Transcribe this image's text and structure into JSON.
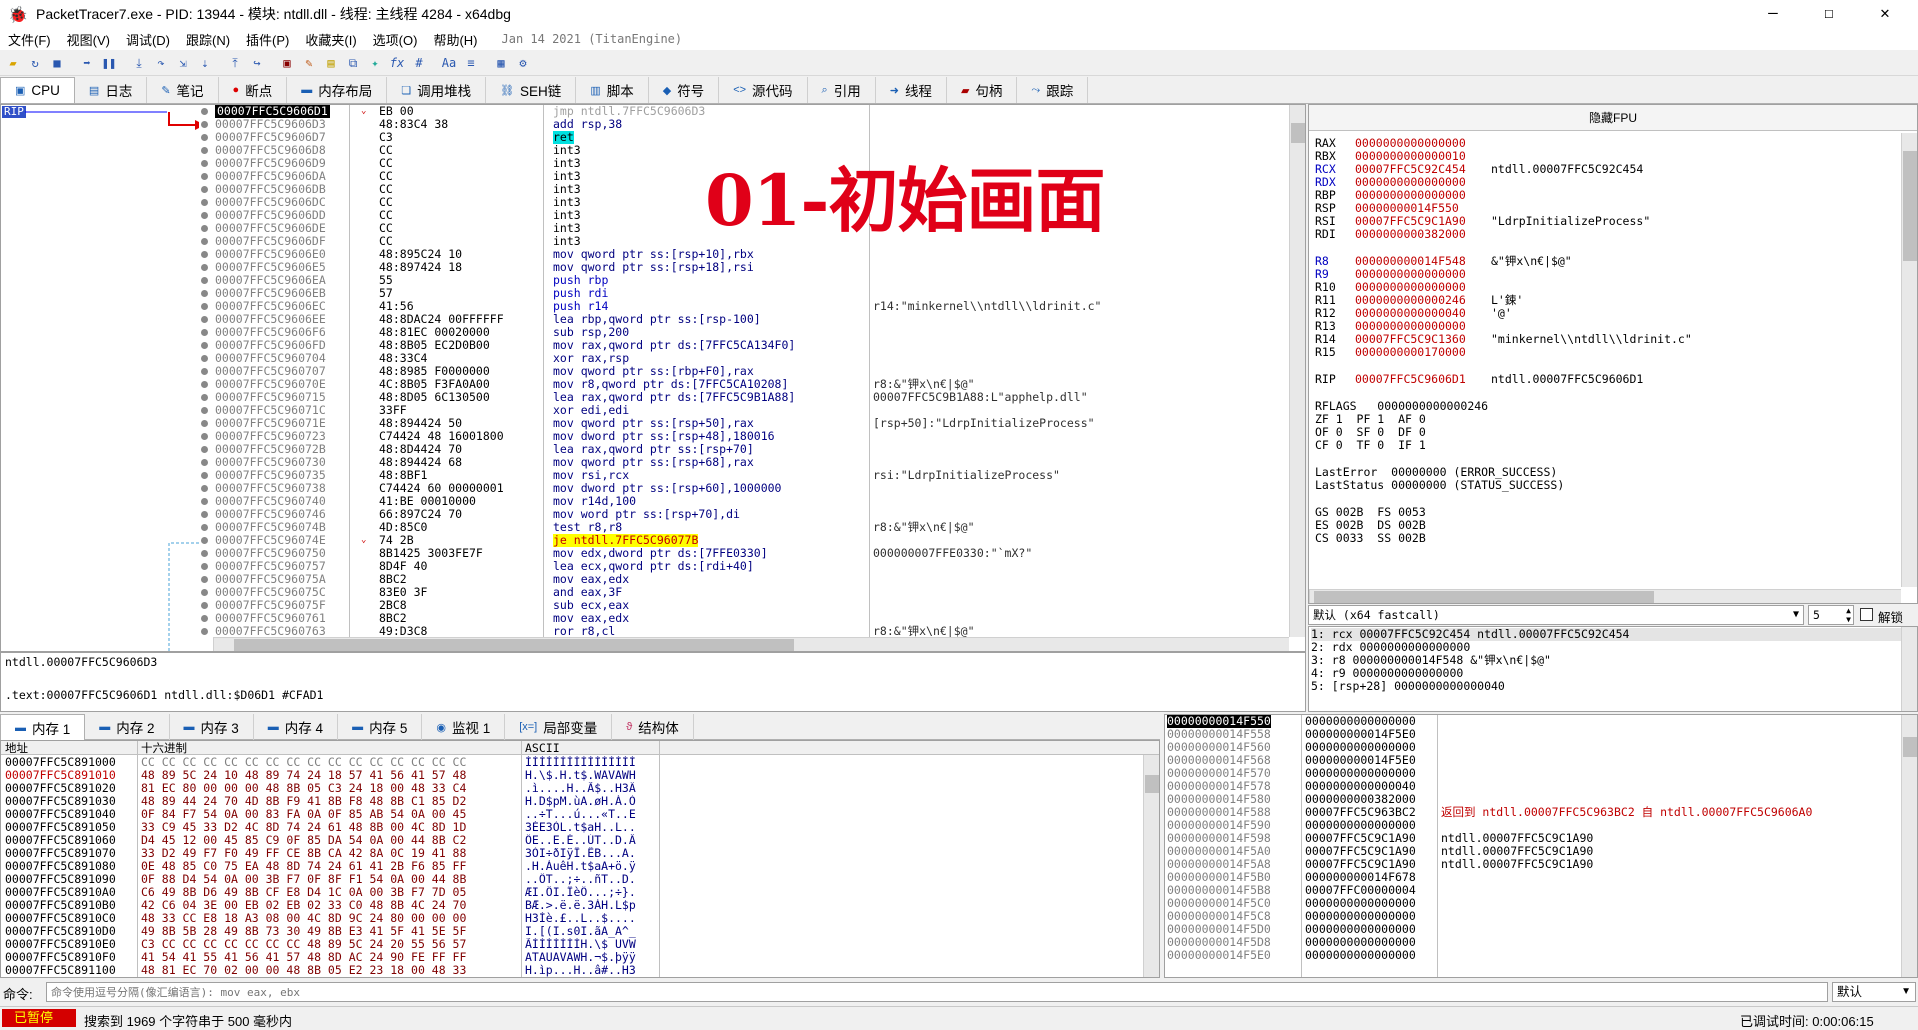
{
  "window": {
    "title": "PacketTracer7.exe - PID: 13944 - 模块: ntdll.dll - 线程: 主线程 4284 - x64dbg",
    "min": "—",
    "max": "☐",
    "close": "✕"
  },
  "menu": [
    "文件(F)",
    "视图(V)",
    "调试(D)",
    "跟踪(N)",
    "插件(P)",
    "收藏夹(I)",
    "选项(O)",
    "帮助(H)",
    "Jan 14 2021 (TitanEngine)"
  ],
  "tabs": [
    {
      "icon": "cpu-icon",
      "label": "CPU"
    },
    {
      "icon": "log-icon",
      "label": "日志"
    },
    {
      "icon": "notes-icon",
      "label": "笔记"
    },
    {
      "icon": "breakpoint-icon",
      "label": "断点"
    },
    {
      "icon": "memory-map-icon",
      "label": "内存布局"
    },
    {
      "icon": "call-stack-icon",
      "label": "调用堆栈"
    },
    {
      "icon": "seh-icon",
      "label": "SEH链"
    },
    {
      "icon": "script-icon",
      "label": "脚本"
    },
    {
      "icon": "symbol-icon",
      "label": "符号"
    },
    {
      "icon": "source-icon",
      "label": "源代码"
    },
    {
      "icon": "reference-icon",
      "label": "引用"
    },
    {
      "icon": "thread-icon",
      "label": "线程"
    },
    {
      "icon": "handle-icon",
      "label": "句柄"
    },
    {
      "icon": "trace-icon",
      "label": "跟踪"
    }
  ],
  "rip_label": "RIP",
  "overlay_text": "01-初始画面",
  "disasm": [
    [
      "00007FFC5C9606D1",
      "EB 00",
      "jmp ntdll.7FFC5C9606D3",
      ""
    ],
    [
      "00007FFC5C9606D3",
      "48:83C4 38",
      "add rsp,38",
      ""
    ],
    [
      "00007FFC5C9606D7",
      "C3",
      "ret",
      ""
    ],
    [
      "00007FFC5C9606D8",
      "CC",
      "int3",
      ""
    ],
    [
      "00007FFC5C9606D9",
      "CC",
      "int3",
      ""
    ],
    [
      "00007FFC5C9606DA",
      "CC",
      "int3",
      ""
    ],
    [
      "00007FFC5C9606DB",
      "CC",
      "int3",
      ""
    ],
    [
      "00007FFC5C9606DC",
      "CC",
      "int3",
      ""
    ],
    [
      "00007FFC5C9606DD",
      "CC",
      "int3",
      ""
    ],
    [
      "00007FFC5C9606DE",
      "CC",
      "int3",
      ""
    ],
    [
      "00007FFC5C9606DF",
      "CC",
      "int3",
      ""
    ],
    [
      "00007FFC5C9606E0",
      "48:895C24 10",
      "mov qword ptr ss:[rsp+10],rbx",
      ""
    ],
    [
      "00007FFC5C9606E5",
      "48:897424 18",
      "mov qword ptr ss:[rsp+18],rsi",
      ""
    ],
    [
      "00007FFC5C9606EA",
      "55",
      "push rbp",
      ""
    ],
    [
      "00007FFC5C9606EB",
      "57",
      "push rdi",
      ""
    ],
    [
      "00007FFC5C9606EC",
      "41:56",
      "push r14",
      "r14:\"minkernel\\\\ntdll\\\\ldrinit.c\""
    ],
    [
      "00007FFC5C9606EE",
      "48:8DAC24 00FFFFFF",
      "lea rbp,qword ptr ss:[rsp-100]",
      ""
    ],
    [
      "00007FFC5C9606F6",
      "48:81EC 00020000",
      "sub rsp,200",
      ""
    ],
    [
      "00007FFC5C9606FD",
      "48:8B05 EC2D0B00",
      "mov rax,qword ptr ds:[7FFC5CA134F0]",
      ""
    ],
    [
      "00007FFC5C960704",
      "48:33C4",
      "xor rax,rsp",
      ""
    ],
    [
      "00007FFC5C960707",
      "48:8985 F0000000",
      "mov qword ptr ss:[rbp+F0],rax",
      ""
    ],
    [
      "00007FFC5C96070E",
      "4C:8B05 F3FA0A00",
      "mov r8,qword ptr ds:[7FFC5CA10208]",
      "r8:&\"钾x\\n€|$@\""
    ],
    [
      "00007FFC5C960715",
      "48:8D05 6C130500",
      "lea rax,qword ptr ds:[7FFC5C9B1A88]",
      "00007FFC5C9B1A88:L\"apphelp.dll\""
    ],
    [
      "00007FFC5C96071C",
      "33FF",
      "xor edi,edi",
      ""
    ],
    [
      "00007FFC5C96071E",
      "48:894424 50",
      "mov qword ptr ss:[rsp+50],rax",
      "[rsp+50]:\"LdrpInitializeProcess\""
    ],
    [
      "00007FFC5C960723",
      "C74424 48 16001800",
      "mov dword ptr ss:[rsp+48],180016",
      ""
    ],
    [
      "00007FFC5C96072B",
      "48:8D4424 70",
      "lea rax,qword ptr ss:[rsp+70]",
      ""
    ],
    [
      "00007FFC5C960730",
      "48:894424 68",
      "mov qword ptr ss:[rsp+68],rax",
      ""
    ],
    [
      "00007FFC5C960735",
      "48:8BF1",
      "mov rsi,rcx",
      "rsi:\"LdrpInitializeProcess\""
    ],
    [
      "00007FFC5C960738",
      "C74424 60 00000001",
      "mov dword ptr ss:[rsp+60],1000000",
      ""
    ],
    [
      "00007FFC5C960740",
      "41:BE 00010000",
      "mov r14d,100",
      ""
    ],
    [
      "00007FFC5C960746",
      "66:897C24 70",
      "mov word ptr ss:[rsp+70],di",
      ""
    ],
    [
      "00007FFC5C96074B",
      "4D:85C0",
      "test r8,r8",
      "r8:&\"钾x\\n€|$@\""
    ],
    [
      "00007FFC5C96074E",
      "74 2B",
      "je ntdll.7FFC5C96077B",
      ""
    ],
    [
      "00007FFC5C960750",
      "8B1425 3003FE7F",
      "mov edx,dword ptr ds:[7FFE0330]",
      "000000007FFE0330:\"`mX?\""
    ],
    [
      "00007FFC5C960757",
      "8D4F 40",
      "lea ecx,qword ptr ds:[rdi+40]",
      ""
    ],
    [
      "00007FFC5C96075A",
      "8BC2",
      "mov eax,edx",
      ""
    ],
    [
      "00007FFC5C96075C",
      "83E0 3F",
      "and eax,3F",
      ""
    ],
    [
      "00007FFC5C96075F",
      "2BC8",
      "sub ecx,eax",
      ""
    ],
    [
      "00007FFC5C960761",
      "8BC2",
      "mov eax,edx",
      ""
    ],
    [
      "00007FFC5C960763",
      "49:D3C8",
      "ror r8,cl",
      "r8:&\"钾x\\n€|$@\""
    ]
  ],
  "info": {
    "line1": "ntdll.00007FFC5C9606D3",
    "line2": ".text:00007FFC5C9606D1 ntdll.dll:$D06D1 #CFAD1"
  },
  "regs": {
    "header": "隐藏FPU",
    "gp": [
      [
        "RAX",
        "0000000000000000",
        ""
      ],
      [
        "RBX",
        "0000000000000010",
        ""
      ],
      [
        "RCX",
        "00007FFC5C92C454",
        "ntdll.00007FFC5C92C454"
      ],
      [
        "RDX",
        "0000000000000000",
        ""
      ],
      [
        "RBP",
        "0000000000000000",
        ""
      ],
      [
        "RSP",
        "00000000014F550",
        ""
      ],
      [
        "RSI",
        "00007FFC5C9C1A90",
        "\"LdrpInitializeProcess\""
      ],
      [
        "RDI",
        "0000000000382000",
        ""
      ]
    ],
    "ext": [
      [
        "R8",
        "000000000014F548",
        "&\"钾x\\n€|$@\""
      ],
      [
        "R9",
        "0000000000000000",
        ""
      ],
      [
        "R10",
        "0000000000000000",
        ""
      ],
      [
        "R11",
        "0000000000000246",
        "L'鋉'"
      ],
      [
        "R12",
        "0000000000000040",
        "'@'"
      ],
      [
        "R13",
        "0000000000000000",
        ""
      ],
      [
        "R14",
        "00007FFC5C9C1360",
        "\"minkernel\\\\ntdll\\\\ldrinit.c\""
      ],
      [
        "R15",
        "0000000000170000",
        ""
      ]
    ],
    "rip": [
      "RIP",
      "00007FFC5C9606D1",
      "ntdll.00007FFC5C9606D1"
    ],
    "flags": [
      "RFLAGS   0000000000000246",
      "ZF 1  PF 1  AF 0",
      "OF 0  SF 0  DF 0",
      "CF 0  TF 0  IF 1"
    ],
    "err": [
      "LastError  00000000 (ERROR_SUCCESS)",
      "LastStatus 00000000 (STATUS_SUCCESS)"
    ],
    "seg": [
      "GS 002B  FS 0053",
      "ES 002B  DS 002B",
      "CS 0033  SS 002B"
    ]
  },
  "callconv": {
    "select": "默认 (x64 fastcall)",
    "count": "5",
    "unlock": "解锁",
    "args": [
      "1: rcx 00007FFC5C92C454 ntdll.00007FFC5C92C454",
      "2: rdx 0000000000000000",
      "3: r8 000000000014F548 &\"钾x\\n€|$@\"",
      "4: r9 0000000000000000",
      "5: [rsp+28] 0000000000000040"
    ]
  },
  "memtabs": [
    {
      "icon": "memory-icon",
      "label": "内存 1"
    },
    {
      "icon": "memory-icon",
      "label": "内存 2"
    },
    {
      "icon": "memory-icon",
      "label": "内存 3"
    },
    {
      "icon": "memory-icon",
      "label": "内存 4"
    },
    {
      "icon": "memory-icon",
      "label": "内存 5"
    },
    {
      "icon": "watch-icon",
      "label": "监视 1"
    },
    {
      "icon": "locals-icon",
      "label": "局部变量"
    },
    {
      "icon": "struct-icon",
      "label": "结构体"
    }
  ],
  "dump": {
    "h_addr": "地址",
    "h_hex": "十六进制",
    "h_ascii": "ASCII",
    "rows": [
      [
        "00007FFC5C891000",
        "CC CC CC CC CC CC CC CC CC CC CC CC CC CC CC CC",
        "ÌÌÌÌÌÌÌÌÌÌÌÌÌÌÌÌ"
      ],
      [
        "00007FFC5C891010",
        "48 89 5C 24 10 48 89 74 24 18 57 41 56 41 57 48",
        "H.\\$.H.t$.WAVAWH"
      ],
      [
        "00007FFC5C891020",
        "81 EC 80 00 00 00 48 8B 05 C3 24 18 00 48 33 C4",
        ".ì....H..Ã$..H3Ä"
      ],
      [
        "00007FFC5C891030",
        "48 89 44 24 70 4D 8B F9 41 8B F8 48 8B C1 85 D2",
        "H.D$pM.ùA.øH.Á.Ò"
      ],
      [
        "00007FFC5C891040",
        "0F 84 F7 54 0A 00 83 FA 0A 0F 85 AB 54 0A 00 45",
        "..÷T...ú...«T..E"
      ],
      [
        "00007FFC5C891050",
        "33 C9 45 33 D2 4C 8D 74 24 61 48 8B 00 4C 8D 1D",
        "3ÉE3ÒL.t$aH..L.."
      ],
      [
        "00007FFC5C891060",
        "D4 45 12 00 45 85 C9 0F 85 DA 54 0A 00 44 8B C2",
        "ÔE..E.É..ÚT..D.Â"
      ],
      [
        "00007FFC5C891070",
        "33 D2 49 F7 F0 49 FF CE 8B CA 42 8A 0C 19 41 88",
        "3ÒI÷ðIÿÎ.ÊB...A."
      ],
      [
        "00007FFC5C891080",
        "0E 48 85 C0 75 EA 48 8D 74 24 61 41 2B F6 85 FF",
        ".H.ÀuêH.t$aA+ö.ÿ"
      ],
      [
        "00007FFC5C891090",
        "0F 88 D4 54 0A 00 3B F7 0F 8F F1 54 0A 00 44 8B",
        "..ÔT..;÷..ñT..D."
      ],
      [
        "00007FFC5C8910A0",
        "C6 49 8B D6 49 8B CF E8 D4 1C 0A 00 3B F7 7D 05",
        "ÆI.ÖI.ÏèÔ...;÷}."
      ],
      [
        "00007FFC5C8910B0",
        "42 C6 04 3E 00 EB 02 EB 02 33 C0 48 8B 4C 24 70",
        "BÆ.>.ë.ë.3ÀH.L$p"
      ],
      [
        "00007FFC5C8910C0",
        "48 33 CC E8 18 A3 08 00 4C 8D 9C 24 80 00 00 00",
        "H3Ìè.£..L..$...."
      ],
      [
        "00007FFC5C8910D0",
        "49 8B 5B 28 49 8B 73 30 49 8B E3 41 5F 41 5E 5F",
        "I.[(I.s0I.ãA_A^_"
      ],
      [
        "00007FFC5C8910E0",
        "C3 CC CC CC CC CC CC CC 48 89 5C 24 20 55 56 57",
        "ÃÌÌÌÌÌÌÌH.\\$ UVW"
      ],
      [
        "00007FFC5C8910F0",
        "41 54 41 55 41 56 41 57 48 8D AC 24 90 FE FF FF",
        "ATAUAVAWH.¬$.þÿÿ"
      ],
      [
        "00007FFC5C891100",
        "48 81 EC 70 02 00 00 48 8B 05 E2 23 18 00 48 33",
        "H.ìp...H..â#..H3"
      ]
    ]
  },
  "stack": [
    [
      "00000000014F550",
      "0000000000000000",
      ""
    ],
    [
      "00000000014F558",
      "000000000014F5E0",
      ""
    ],
    [
      "00000000014F560",
      "0000000000000000",
      ""
    ],
    [
      "00000000014F568",
      "000000000014F5E0",
      ""
    ],
    [
      "00000000014F570",
      "0000000000000000",
      ""
    ],
    [
      "00000000014F578",
      "0000000000000040",
      ""
    ],
    [
      "00000000014F580",
      "0000000000382000",
      ""
    ],
    [
      "00000000014F588",
      "00007FFC5C963BC2",
      "返回到 ntdll.00007FFC5C963BC2 自 ntdll.00007FFC5C9606A0"
    ],
    [
      "00000000014F590",
      "0000000000000000",
      ""
    ],
    [
      "00000000014F598",
      "00007FFC5C9C1A90",
      "ntdll.00007FFC5C9C1A90"
    ],
    [
      "00000000014F5A0",
      "00007FFC5C9C1A90",
      "ntdll.00007FFC5C9C1A90"
    ],
    [
      "00000000014F5A8",
      "00007FFC5C9C1A90",
      "ntdll.00007FFC5C9C1A90"
    ],
    [
      "00000000014F5B0",
      "000000000014F678",
      ""
    ],
    [
      "00000000014F5B8",
      "00007FFC00000004",
      ""
    ],
    [
      "00000000014F5C0",
      "0000000000000000",
      ""
    ],
    [
      "00000000014F5C8",
      "0000000000000000",
      ""
    ],
    [
      "00000000014F5D0",
      "0000000000000000",
      ""
    ],
    [
      "00000000014F5D8",
      "0000000000000000",
      ""
    ],
    [
      "00000000014F5E0",
      "0000000000000000",
      ""
    ]
  ],
  "cmd": {
    "label": "命令:",
    "placeholder": "命令使用逗号分隔(像汇编语言): mov eax, ebx",
    "right": "默认"
  },
  "status": {
    "state": "已暂停",
    "msg": "搜索到 1969 个字符串于 500 毫秒内",
    "time": "已调试时间:  0:00:06:15"
  }
}
